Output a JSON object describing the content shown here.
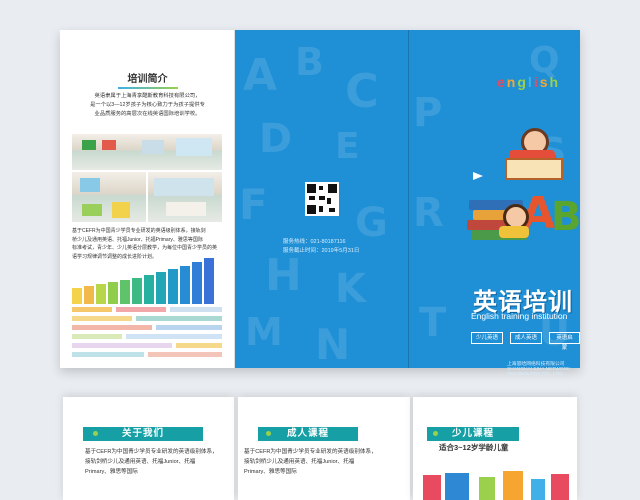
{
  "left_panel": {
    "title": "培训简介",
    "intro": [
      "英语隶属于上海青享酷斯教育科技有限公司，",
      "是一个以3—12岁孩子为核心致力于为孩子提供专",
      "业品质服务的高层次在线英语国际培训学校。"
    ],
    "body": [
      "基于CEFR为中国青少学员专业研发的英语级别体系，接轨剑",
      "桥少儿及通用英语、托福Junior、托福Primary、雅思等国际",
      "标准考试，青少年、少儿英语分层教学，为每位中国青少学员的英",
      "语学习规律调节调整的成长进阶计划。"
    ]
  },
  "middle_panel": {
    "contact_phone": "服务热线：021-80187116",
    "contact_date": "服务截止时间：2019年5月31日"
  },
  "cover": {
    "brand_letters": [
      "e",
      "n",
      "g",
      "l",
      "i",
      "s",
      "h"
    ],
    "brand_colors": [
      "#e84a5f",
      "#f7a531",
      "#9ad04b",
      "#3fb0e8",
      "#e84a5f",
      "#f7a531",
      "#9ad04b"
    ],
    "title": "英语培训",
    "subtitle": "English training institution",
    "tags": [
      "少儿英语",
      "成人英语",
      "英语启蒙"
    ],
    "company": "上海思哈网络科技有限公司 SHANGHAI SIHA NETWORK TECHNOLOGY CO., LTD."
  },
  "bottom": {
    "about": {
      "label": "关于我们",
      "text": [
        "基于CEFR为中国青少学员专业研发的英语级别体系，",
        "接轨剑桥少儿及通用英语、托福Junior、托福",
        "Primary、雅思等国际"
      ]
    },
    "adult": {
      "label": "成人课程",
      "text": [
        "基于CEFR为中国青少学员专业研发的英语级别体系，",
        "接轨剑桥少儿及通用英语、托福Junior、托福",
        "Primary、雅思等国际"
      ]
    },
    "kids": {
      "label": "少儿课程",
      "subtitle": "适合3~12岁学龄儿童"
    }
  }
}
